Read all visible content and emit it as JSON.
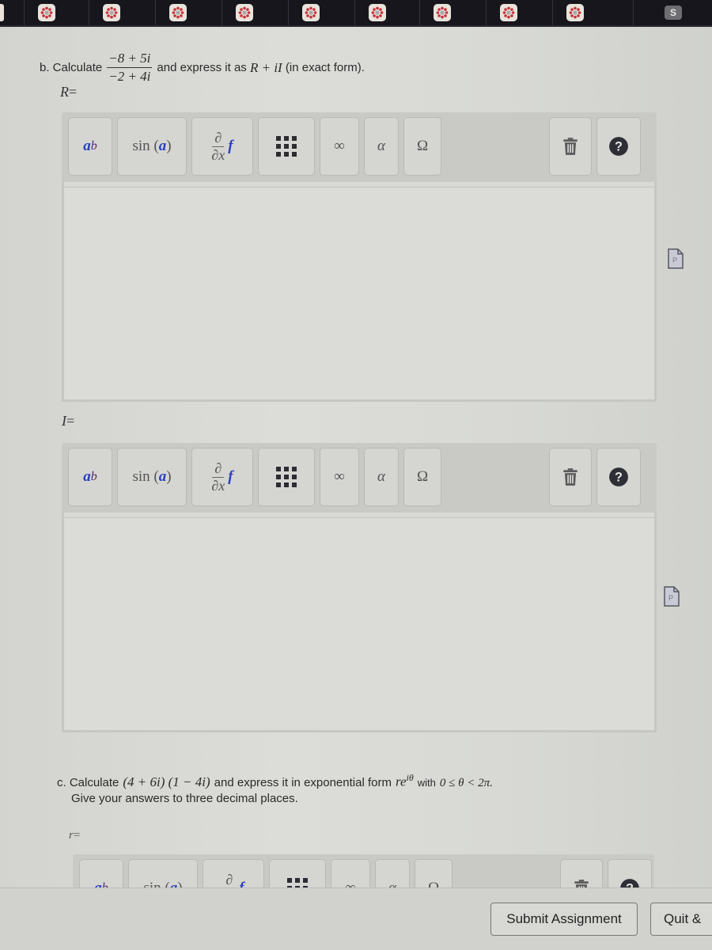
{
  "browser": {
    "tabs": [
      {
        "icon": "canvas-logo-icon"
      },
      {
        "icon": "canvas-logo-icon"
      },
      {
        "icon": "canvas-logo-icon"
      },
      {
        "icon": "canvas-logo-icon"
      },
      {
        "icon": "canvas-logo-icon"
      },
      {
        "icon": "canvas-logo-icon"
      },
      {
        "icon": "canvas-logo-icon"
      },
      {
        "icon": "canvas-logo-icon"
      },
      {
        "icon": "canvas-logo-icon"
      }
    ],
    "profile_tab_letter": "S",
    "accent_color": "#c8323c"
  },
  "question_b": {
    "prefix": "b. Calculate",
    "fraction_numerator": "−8 + 5i",
    "fraction_denominator": "−2 + 4i",
    "suffix_text": "and express it as",
    "form_expression": "R + iI",
    "suffix_note": "(in exact form).",
    "answers": [
      {
        "label": "R",
        "equals": "="
      },
      {
        "label": "I",
        "equals": "="
      }
    ]
  },
  "question_c": {
    "prefix": "c. Calculate",
    "expression": "(4 + 6i) (1 − 4i)",
    "middle_text": "and express it in exponential form",
    "form": "re",
    "form_exponent": "iθ",
    "constraint_prefix": "with",
    "constraint": "0 ≤ θ < 2π.",
    "line2": "Give your answers to three decimal places.",
    "answers": [
      {
        "label": "r",
        "equals": "="
      }
    ]
  },
  "toolbar": {
    "power_base": "a",
    "power_exp": "b",
    "trig_label": "sin",
    "trig_arg": "a",
    "deriv_top": "∂",
    "deriv_bottom": "∂x",
    "deriv_fn": "f",
    "infinity": "∞",
    "alpha": "α",
    "omega": "Ω",
    "trash_icon": "trash-icon",
    "help_icon": "help-icon"
  },
  "footer": {
    "submit_label": "Submit Assignment",
    "quit_label": "Quit &"
  }
}
